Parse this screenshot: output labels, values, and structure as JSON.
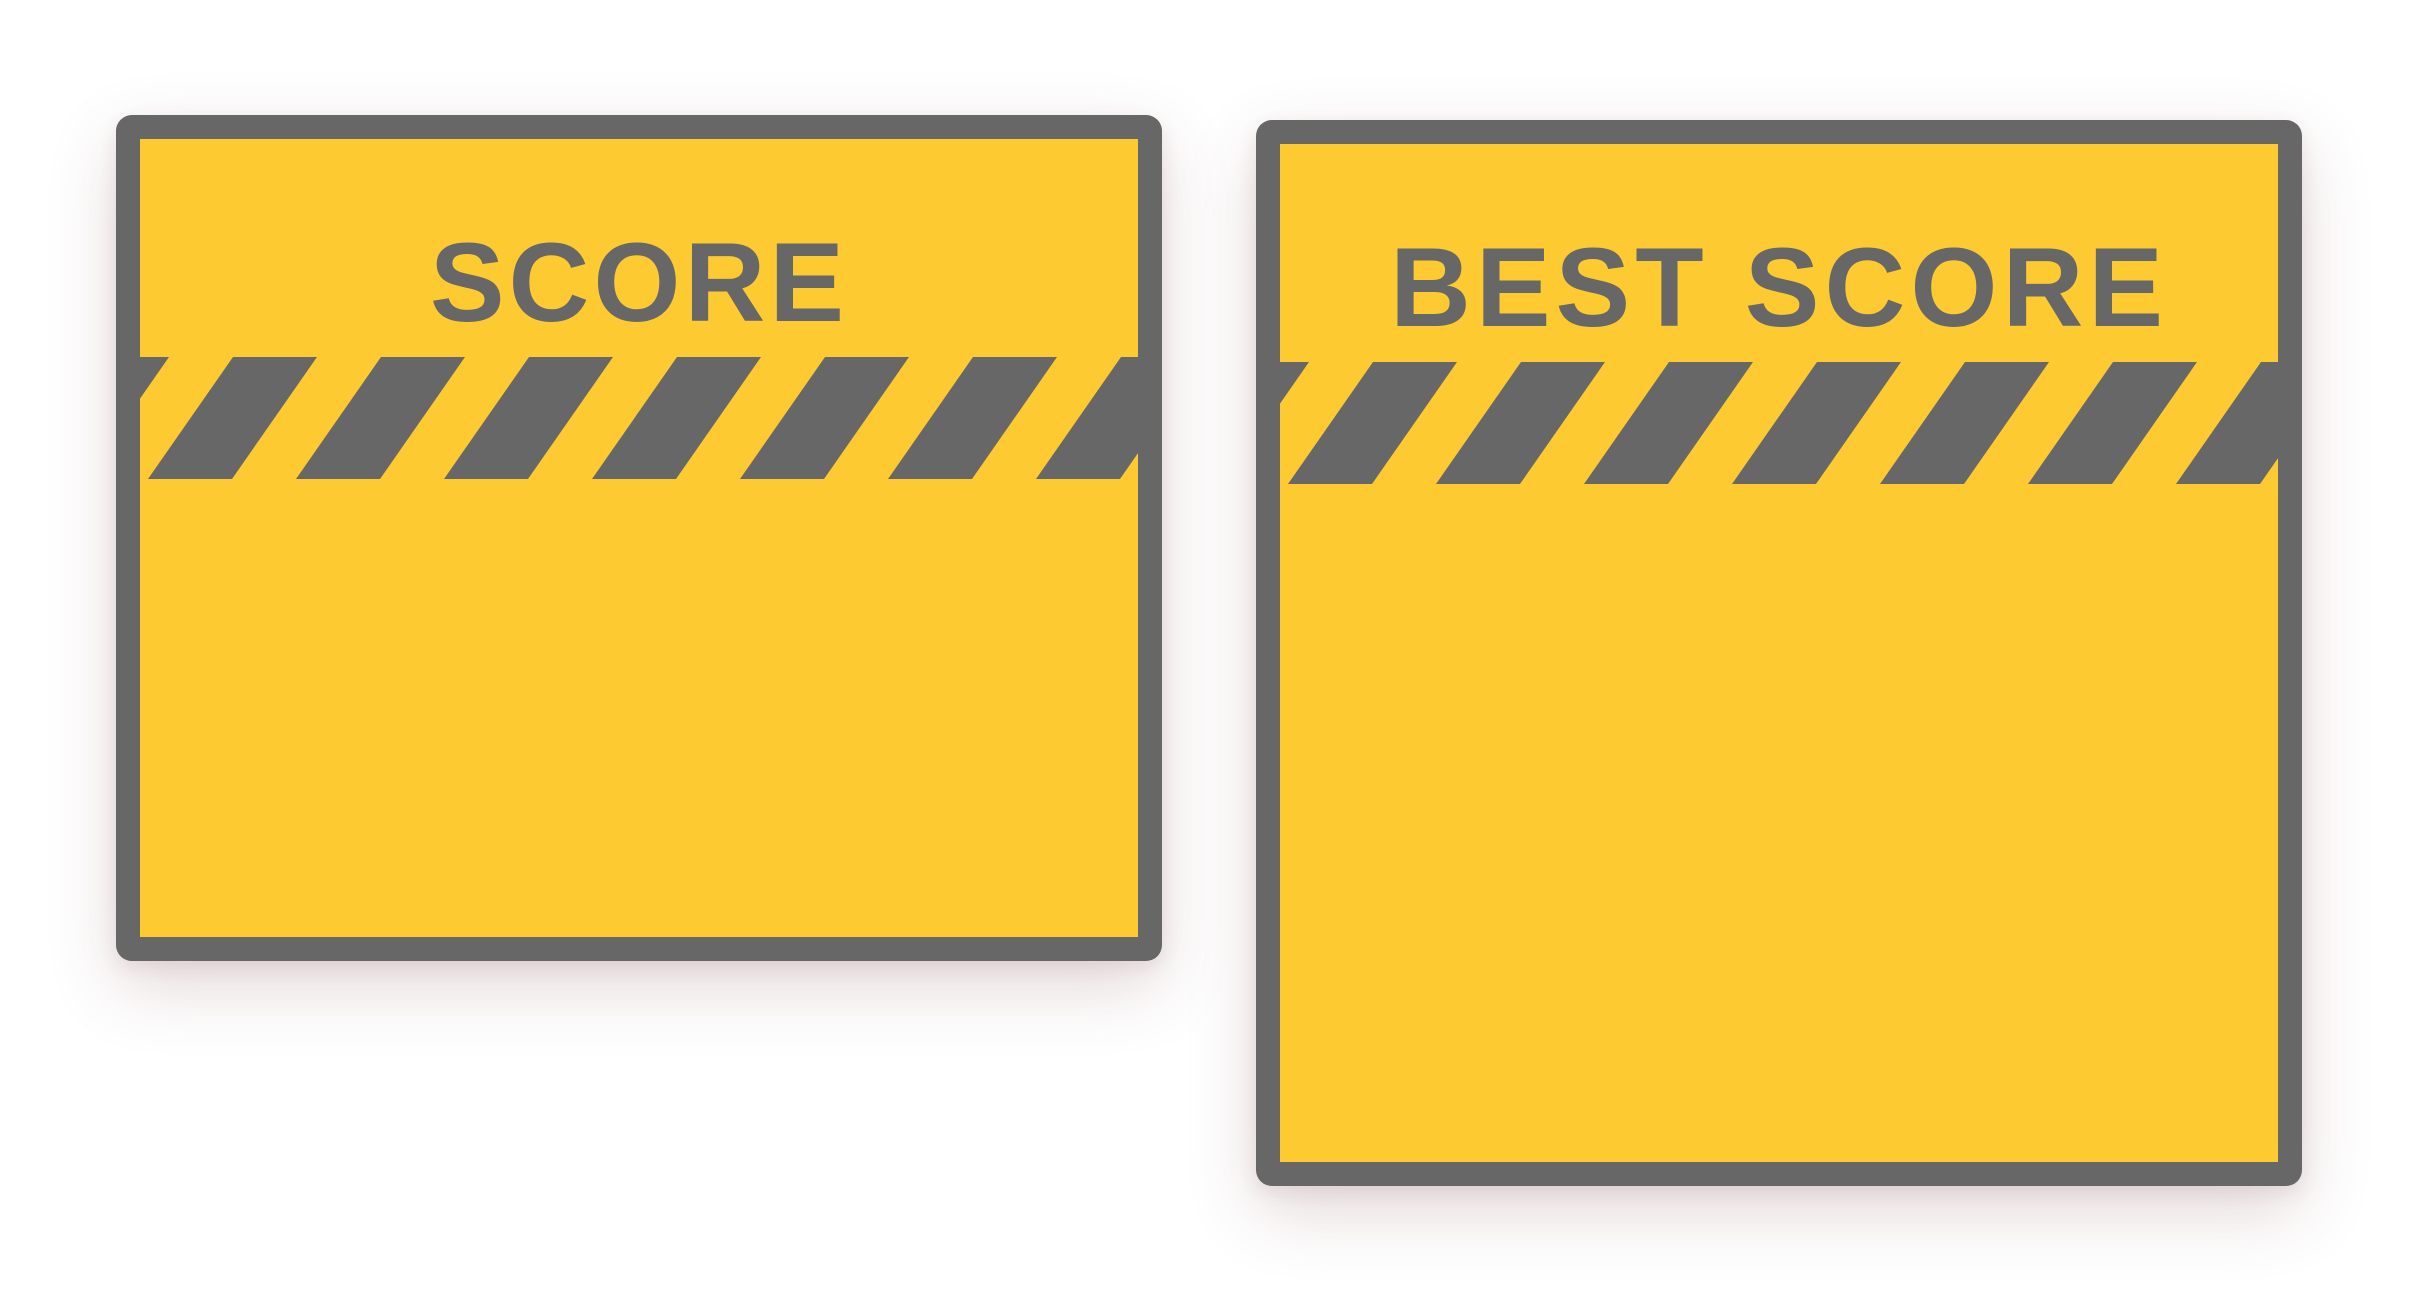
{
  "score_panel": {
    "label": "SCORE",
    "value": ""
  },
  "best_score_panel": {
    "label": "BEST SCORE",
    "value": ""
  },
  "colors": {
    "panel_fill": "#fdca31",
    "panel_border": "#676767",
    "stripe": "#676767",
    "background": "#ffffff"
  },
  "decorations": {
    "stripe_pattern": "hazard-stripes"
  }
}
